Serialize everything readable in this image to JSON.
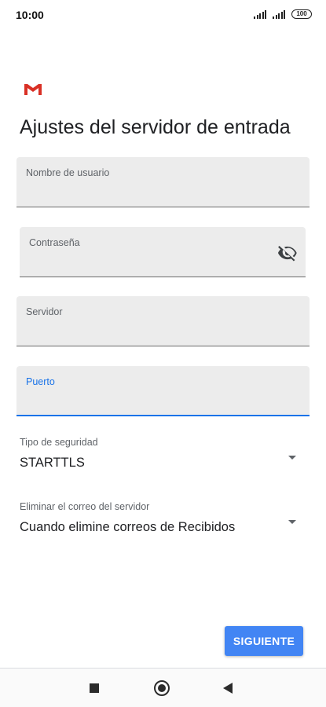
{
  "status_bar": {
    "time": "10:00",
    "battery": "100"
  },
  "app": {
    "logo": "gmail-logo",
    "title": "Ajustes del servidor de entrada"
  },
  "fields": {
    "username": {
      "label": "Nombre de usuario",
      "value": ""
    },
    "password": {
      "label": "Contraseña",
      "value": "",
      "icon": "eye-off-icon"
    },
    "server": {
      "label": "Servidor",
      "value": ""
    },
    "port": {
      "label": "Puerto",
      "value": "",
      "focused": true
    }
  },
  "dropdowns": {
    "security_type": {
      "label": "Tipo de seguridad",
      "value": "STARTTLS"
    },
    "delete_from_server": {
      "label": "Eliminar el correo del servidor",
      "value": "Cuando elimine correos de Recibidos"
    }
  },
  "actions": {
    "next_label": "SIGUIENTE"
  },
  "colors": {
    "accent": "#1a73e8",
    "button": "#4285f4",
    "field_background": "#ececec"
  }
}
